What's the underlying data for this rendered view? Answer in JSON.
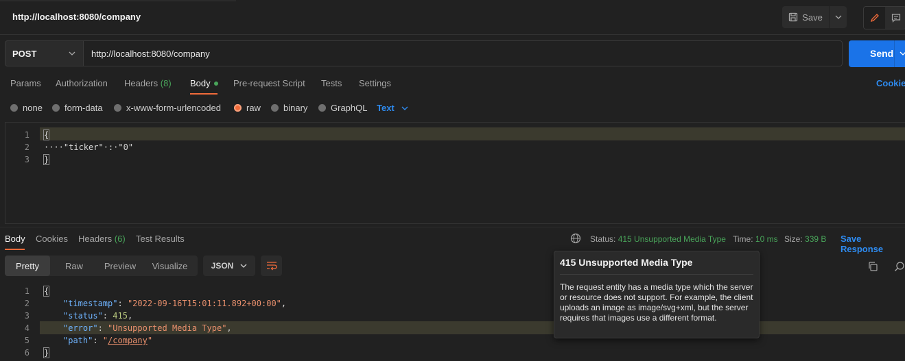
{
  "app": {
    "request_title": "http://localhost:8080/company",
    "save_label": "Save",
    "icons": {
      "save": "save-icon",
      "caret": "chevron-down-icon",
      "edit": "pencil-icon",
      "comment": "comment-icon"
    }
  },
  "request": {
    "method": "POST",
    "url": "http://localhost:8080/company",
    "send_label": "Send",
    "tabs": {
      "params": "Params",
      "authorization": "Authorization",
      "headers": "Headers",
      "headers_count": "(8)",
      "body": "Body",
      "prerequest": "Pre-request Script",
      "tests": "Tests",
      "settings": "Settings"
    },
    "cookies_label": "Cookies",
    "body_types": {
      "none": "none",
      "form_data": "form-data",
      "urlencoded": "x-www-form-urlencoded",
      "raw": "raw",
      "binary": "binary",
      "graphql": "GraphQL"
    },
    "selected_body_type": "raw",
    "raw_format": "Text",
    "editor": {
      "line_numbers": [
        "1",
        "2",
        "3"
      ],
      "lines": [
        "{",
        "····\"ticker\"·:·\"0\"",
        "}"
      ]
    }
  },
  "response": {
    "tabs": {
      "body": "Body",
      "cookies": "Cookies",
      "headers": "Headers",
      "headers_count": "(6)",
      "test_results": "Test Results"
    },
    "status_label": "Status:",
    "status_value": "415 Unsupported Media Type",
    "time_label": "Time:",
    "time_value": "10 ms",
    "size_label": "Size:",
    "size_value": "339 B",
    "save_response_label": "Save Response",
    "views": {
      "pretty": "Pretty",
      "raw": "Raw",
      "preview": "Preview",
      "visualize": "Visualize"
    },
    "format": "JSON",
    "editor": {
      "line_numbers": [
        "1",
        "2",
        "3",
        "4",
        "5",
        "6"
      ],
      "brace_open": "{",
      "brace_close": "}",
      "timestamp_key": "\"timestamp\"",
      "timestamp_val": "\"2022-09-16T15:01:11.892+00:00\"",
      "status_key": "\"status\"",
      "status_val": "415",
      "error_key": "\"error\"",
      "error_val": "\"Unsupported Media Type\"",
      "path_key": "\"path\"",
      "path_q1": "\"",
      "path_val": "/company",
      "path_q2": "\""
    }
  },
  "tooltip": {
    "title": "415 Unsupported Media Type",
    "body": "The request entity has a media type which the server or resource does not support. For example, the client uploads an image as image/svg+xml, but the server requires that images use a different format."
  },
  "colors": {
    "accent": "#f26b3a",
    "link": "#2e8bf0",
    "success": "#49a55a",
    "send": "#1a73e8"
  }
}
